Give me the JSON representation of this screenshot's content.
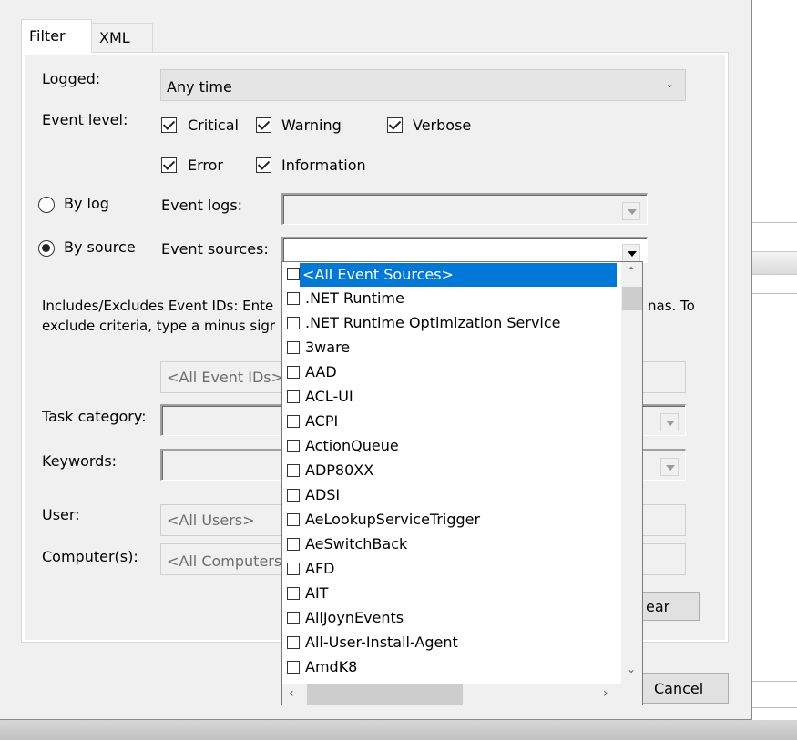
{
  "tabs": [
    {
      "label": "Filter"
    },
    {
      "label": "XML"
    }
  ],
  "filter": {
    "logged_label": "Logged:",
    "logged_value": "Any time",
    "event_level_label": "Event level:",
    "levels": [
      {
        "label": "Critical",
        "checked": true
      },
      {
        "label": "Warning",
        "checked": true
      },
      {
        "label": "Verbose",
        "checked": true
      },
      {
        "label": "Error",
        "checked": true
      },
      {
        "label": "Information",
        "checked": true
      }
    ],
    "by_log_label": "By log",
    "by_source_label": "By source",
    "event_logs_label": "Event logs:",
    "event_sources_label": "Event sources:",
    "includes_text_1": "Includes/Excludes Event IDs: Ente",
    "includes_text_1b": "nas. To",
    "includes_text_2": "exclude criteria, type a minus sigr",
    "event_ids_placeholder": "<All Event IDs>",
    "task_category_label": "Task category:",
    "keywords_label": "Keywords:",
    "user_label": "User:",
    "user_placeholder": "<All Users>",
    "computers_label": "Computer(s):",
    "computers_placeholder": "<All Computers>",
    "clear_label": "ear",
    "cancel_label": "Cancel"
  },
  "sources_list": [
    {
      "label": "<All Event Sources>",
      "selected": true
    },
    {
      "label": ".NET Runtime"
    },
    {
      "label": ".NET Runtime Optimization Service"
    },
    {
      "label": "3ware"
    },
    {
      "label": "AAD"
    },
    {
      "label": "ACL-UI"
    },
    {
      "label": "ACPI"
    },
    {
      "label": "ActionQueue"
    },
    {
      "label": "ADP80XX"
    },
    {
      "label": "ADSI"
    },
    {
      "label": "AeLookupServiceTrigger"
    },
    {
      "label": "AeSwitchBack"
    },
    {
      "label": "AFD"
    },
    {
      "label": "AIT"
    },
    {
      "label": "AllJoynEvents"
    },
    {
      "label": "All-User-Install-Agent"
    },
    {
      "label": "AmdK8"
    }
  ],
  "colors": {
    "selection": "#0078d7",
    "dialog_bg": "#f0f0f0"
  },
  "icons": {
    "up": "chevron-up-icon",
    "down": "chevron-down-icon",
    "left": "chevron-left-icon",
    "right": "chevron-right-icon"
  }
}
